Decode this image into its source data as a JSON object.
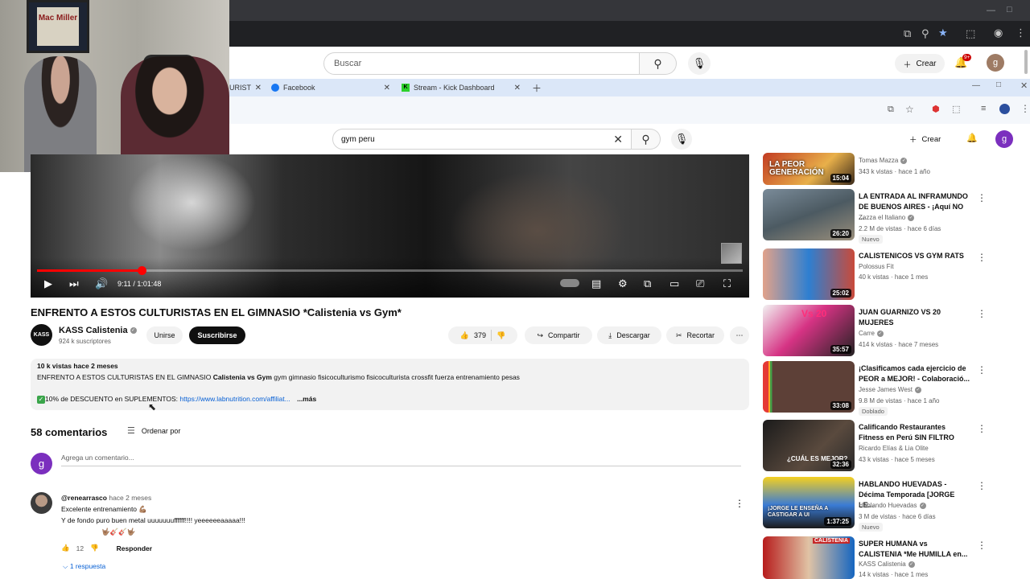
{
  "outer_browser": {
    "search_placeholder": "Buscar",
    "create_label": "Crear",
    "notif_count": "9+",
    "avatar_letter": "g"
  },
  "inner_tabs": [
    {
      "label": "URIST",
      "favicon": "youtube"
    },
    {
      "label": "Facebook",
      "favicon": "facebook"
    },
    {
      "label": "Stream - Kick Dashboard",
      "favicon": "kick"
    }
  ],
  "inner_youtube": {
    "search_query": "gym peru",
    "create_label": "Crear",
    "avatar_letter": "g"
  },
  "webcam": {
    "poster_text": "Mac Miller"
  },
  "player": {
    "time": "9:11 / 1:01:48",
    "progress_fraction": 0.148
  },
  "video": {
    "title": "ENFRENTO A ESTOS CULTURISTAS EN EL GIMNASIO *Calistenia vs Gym*",
    "channel_logo_text": "KASS",
    "channel_name": "KASS Calistenia",
    "subscribers": "924 k suscriptores",
    "join_label": "Unirse",
    "subscribe_label": "Suscribirse",
    "likes": "379",
    "share_label": "Compartir",
    "download_label": "Descargar",
    "clip_label": "Recortar"
  },
  "description": {
    "stats": "10 k vistas  hace 2 meses",
    "line1_prefix": "ENFRENTO A ESTOS CULTURISTAS EN EL GIMNASIO ",
    "line1_bold": "Calistenia vs Gym",
    "line1_suffix": " gym gimnasio fisicoculturismo fisicoculturista crossfit fuerza entrenamiento pesas",
    "promo_text": "10% de DESCUENTO en SUPLEMENTOS: ",
    "promo_link": "https://www.labnutrition.com/affiliat...",
    "more_label": "...más"
  },
  "comments": {
    "count_label": "58 comentarios",
    "sort_label": "Ordenar por",
    "add_placeholder": "Agrega un comentario...",
    "me_letter": "g",
    "items": [
      {
        "author": "@renearrasco",
        "time": "hace 2 meses",
        "line1": "Excelente entrenamiento 💪🏽",
        "line2": "Y de fondo puro buen metal  uuuuuuuffffff!!!!  yeeeeeeaaaaa!!!",
        "line3": "🤟🏽🎸🎸🤟🏽",
        "likes": "12",
        "reply_label": "Responder",
        "replies_label": "1 respuesta"
      }
    ]
  },
  "recommendations": [
    {
      "title": "",
      "channel": "Tomas Mazza",
      "meta": "343 k vistas · hace 1 año",
      "duration": "15:04",
      "badge": "",
      "thumb_text": "LA PEOR GENERACIÓN"
    },
    {
      "title": "LA ENTRADA AL INFRAMUNDO DE BUENOS AIRES - ¡Aquí NO ...",
      "channel": "Zazza el Italiano",
      "meta": "2.2 M de vistas · hace 6 días",
      "duration": "26:20",
      "badge": "Nuevo",
      "thumb_text": ""
    },
    {
      "title": "CALISTENICOS VS GYM RATS",
      "channel": "Polossus Fit",
      "meta": "40 k vistas · hace 1 mes",
      "duration": "25:02",
      "badge": "",
      "thumb_text": ""
    },
    {
      "title": "JUAN GUARNIZO VS 20 MUJERES",
      "channel": "Carre",
      "meta": "414 k vistas · hace 7 meses",
      "duration": "35:57",
      "badge": "",
      "thumb_text": "Vs 20"
    },
    {
      "title": "¡Clasificamos cada ejercicio de PEOR a MEJOR! - Colaboració...",
      "channel": "Jesse James West",
      "meta": "9.8 M de vistas · hace 1 año",
      "duration": "33:08",
      "badge": "Doblado",
      "thumb_text": ""
    },
    {
      "title": "Calificando Restaurantes Fitness en Perú SIN FILTRO",
      "channel": "Ricardo Elías & Lia Olite",
      "meta": "43 k vistas · hace 5 meses",
      "duration": "32:36",
      "badge": "",
      "thumb_text": "¿CUÁL ES MEJOR?"
    },
    {
      "title": "HABLANDO HUEVADAS - Décima Temporada [JORGE LE...",
      "channel": "Hablando Huevadas",
      "meta": "3 M de vistas · hace 6 días",
      "duration": "1:37:25",
      "badge": "Nuevo",
      "thumb_text": "¡JORGE LE ENSEÑA A CASTIGAR A UI"
    },
    {
      "title": "SUPER HUMANA vs CALISTENIA *Me HUMILLA en...",
      "channel": "KASS Calistenia",
      "meta": "14 k vistas · hace 1 mes",
      "duration": "",
      "badge": "",
      "thumb_text": "CALISTENIA"
    }
  ],
  "colors": {
    "accent_red": "#ff0000",
    "avatar_purple": "#7b2fbe",
    "link_blue": "#065fd4"
  }
}
